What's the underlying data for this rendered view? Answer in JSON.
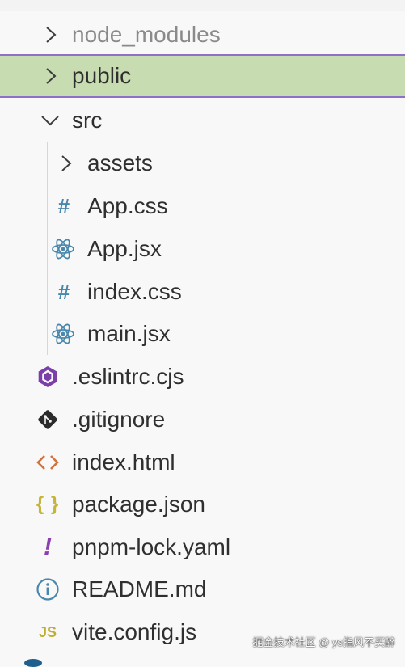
{
  "explorer": {
    "items": [
      {
        "label": "node_modules",
        "icon": "chevron-right-icon",
        "dimmed": true
      },
      {
        "label": "public",
        "icon": "chevron-right-icon",
        "selected": true
      },
      {
        "label": "src",
        "icon": "chevron-down-icon",
        "expanded": true
      },
      {
        "label": "assets",
        "icon": "chevron-right-icon"
      },
      {
        "label": "App.css",
        "icon": "css-hash-icon",
        "icon_glyph": "#"
      },
      {
        "label": "App.jsx",
        "icon": "react-icon"
      },
      {
        "label": "index.css",
        "icon": "css-hash-icon",
        "icon_glyph": "#"
      },
      {
        "label": "main.jsx",
        "icon": "react-icon"
      },
      {
        "label": ".eslintrc.cjs",
        "icon": "eslint-icon"
      },
      {
        "label": ".gitignore",
        "icon": "git-icon"
      },
      {
        "label": "index.html",
        "icon": "html-icon"
      },
      {
        "label": "package.json",
        "icon": "json-braces-icon",
        "icon_glyph": "{ }"
      },
      {
        "label": "pnpm-lock.yaml",
        "icon": "yaml-icon",
        "icon_glyph": "!"
      },
      {
        "label": "README.md",
        "icon": "info-icon"
      },
      {
        "label": "vite.config.js",
        "icon": "js-icon",
        "icon_glyph": "JS"
      }
    ]
  },
  "watermark": "掘金技术社区 @ ys指风不买醉",
  "colors": {
    "selection_bg": "#c7dcb0",
    "selection_border": "#8e70c9",
    "css_icon": "#4a87ad",
    "react_icon": "#4a87ad",
    "eslint_icon": "#7b3fa8",
    "git_icon": "#2b2b2b",
    "html_icon": "#d0733e",
    "json_icon": "#c5b53b",
    "yaml_icon": "#8b3fb0",
    "info_icon": "#4a87ad",
    "js_icon": "#bfae30"
  }
}
